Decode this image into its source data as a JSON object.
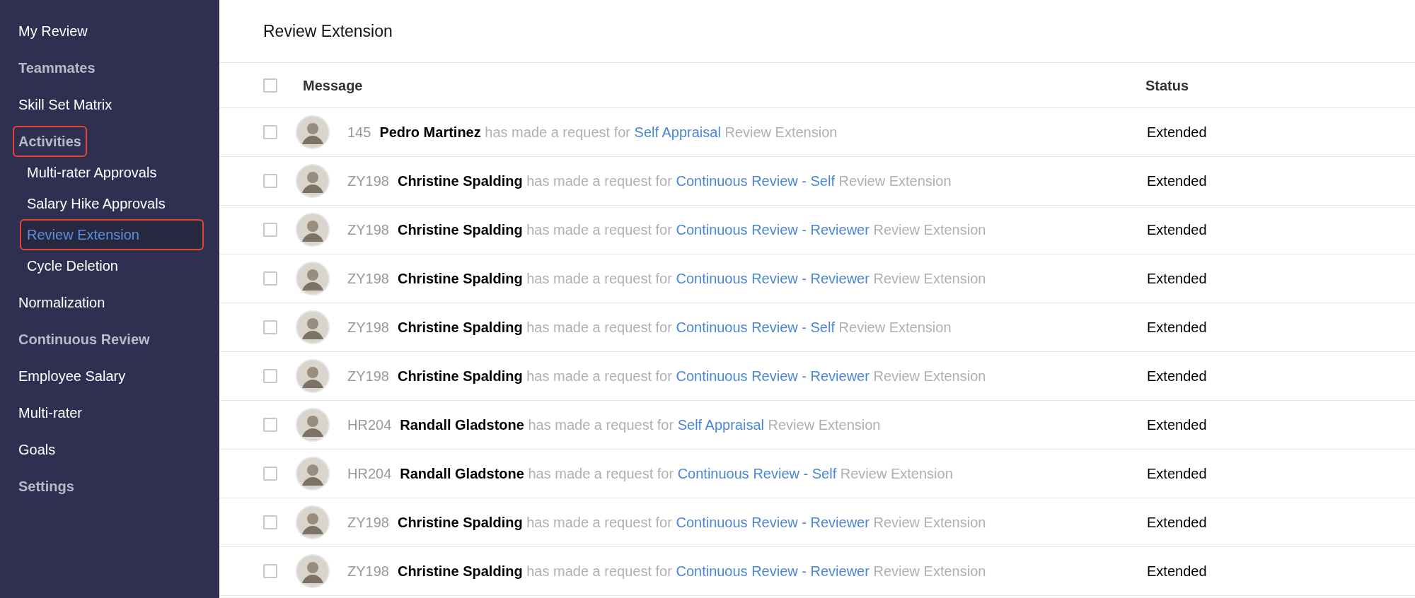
{
  "sidebar": {
    "items": [
      {
        "label": "My Review",
        "kind": "link",
        "selected": false,
        "highlighted": false
      },
      {
        "label": "Teammates",
        "kind": "section",
        "selected": false,
        "highlighted": false
      },
      {
        "label": "Skill Set Matrix",
        "kind": "link",
        "selected": false,
        "highlighted": false
      },
      {
        "label": "Activities",
        "kind": "section",
        "selected": false,
        "highlighted": true,
        "children": [
          {
            "label": "Multi-rater Approvals",
            "selected": false,
            "highlighted": false
          },
          {
            "label": "Salary Hike Approvals",
            "selected": false,
            "highlighted": false
          },
          {
            "label": "Review Extension",
            "selected": true,
            "highlighted": true
          },
          {
            "label": "Cycle Deletion",
            "selected": false,
            "highlighted": false
          }
        ]
      },
      {
        "label": "Normalization",
        "kind": "link",
        "selected": false,
        "highlighted": false
      },
      {
        "label": "Continuous Review",
        "kind": "section",
        "selected": false,
        "highlighted": false
      },
      {
        "label": "Employee Salary",
        "kind": "link",
        "selected": false,
        "highlighted": false
      },
      {
        "label": "Multi-rater",
        "kind": "link",
        "selected": false,
        "highlighted": false
      },
      {
        "label": "Goals",
        "kind": "link",
        "selected": false,
        "highlighted": false
      },
      {
        "label": "Settings",
        "kind": "section",
        "selected": false,
        "highlighted": false
      }
    ]
  },
  "page": {
    "title": "Review Extension"
  },
  "table": {
    "select_all": {
      "checked": false
    },
    "columns": [
      "Message",
      "Status"
    ],
    "rows": [
      {
        "checked": false,
        "id": "145",
        "name": "Pedro Martinez",
        "action": "has made a request for",
        "module": "Self Appraisal",
        "suffix": "Review Extension",
        "status": "Extended"
      },
      {
        "checked": false,
        "id": "ZY198",
        "name": "Christine Spalding",
        "action": "has made a request for",
        "module": "Continuous Review - Self",
        "suffix": "Review Extension",
        "status": "Extended"
      },
      {
        "checked": false,
        "id": "ZY198",
        "name": "Christine Spalding",
        "action": "has made a request for",
        "module": "Continuous Review - Reviewer",
        "suffix": "Review Extension",
        "status": "Extended"
      },
      {
        "checked": false,
        "id": "ZY198",
        "name": "Christine Spalding",
        "action": "has made a request for",
        "module": "Continuous Review - Reviewer",
        "suffix": "Review Extension",
        "status": "Extended"
      },
      {
        "checked": false,
        "id": "ZY198",
        "name": "Christine Spalding",
        "action": "has made a request for",
        "module": "Continuous Review - Self",
        "suffix": "Review Extension",
        "status": "Extended"
      },
      {
        "checked": false,
        "id": "ZY198",
        "name": "Christine Spalding",
        "action": "has made a request for",
        "module": "Continuous Review - Reviewer",
        "suffix": "Review Extension",
        "status": "Extended"
      },
      {
        "checked": false,
        "id": "HR204",
        "name": "Randall Gladstone",
        "action": "has made a request for",
        "module": "Self Appraisal",
        "suffix": "Review Extension",
        "status": "Extended"
      },
      {
        "checked": false,
        "id": "HR204",
        "name": "Randall Gladstone",
        "action": "has made a request for",
        "module": "Continuous Review - Self",
        "suffix": "Review Extension",
        "status": "Extended"
      },
      {
        "checked": false,
        "id": "ZY198",
        "name": "Christine Spalding",
        "action": "has made a request for",
        "module": "Continuous Review - Reviewer",
        "suffix": "Review Extension",
        "status": "Extended"
      },
      {
        "checked": false,
        "id": "ZY198",
        "name": "Christine Spalding",
        "action": "has made a request for",
        "module": "Continuous Review - Reviewer",
        "suffix": "Review Extension",
        "status": "Extended"
      }
    ]
  }
}
